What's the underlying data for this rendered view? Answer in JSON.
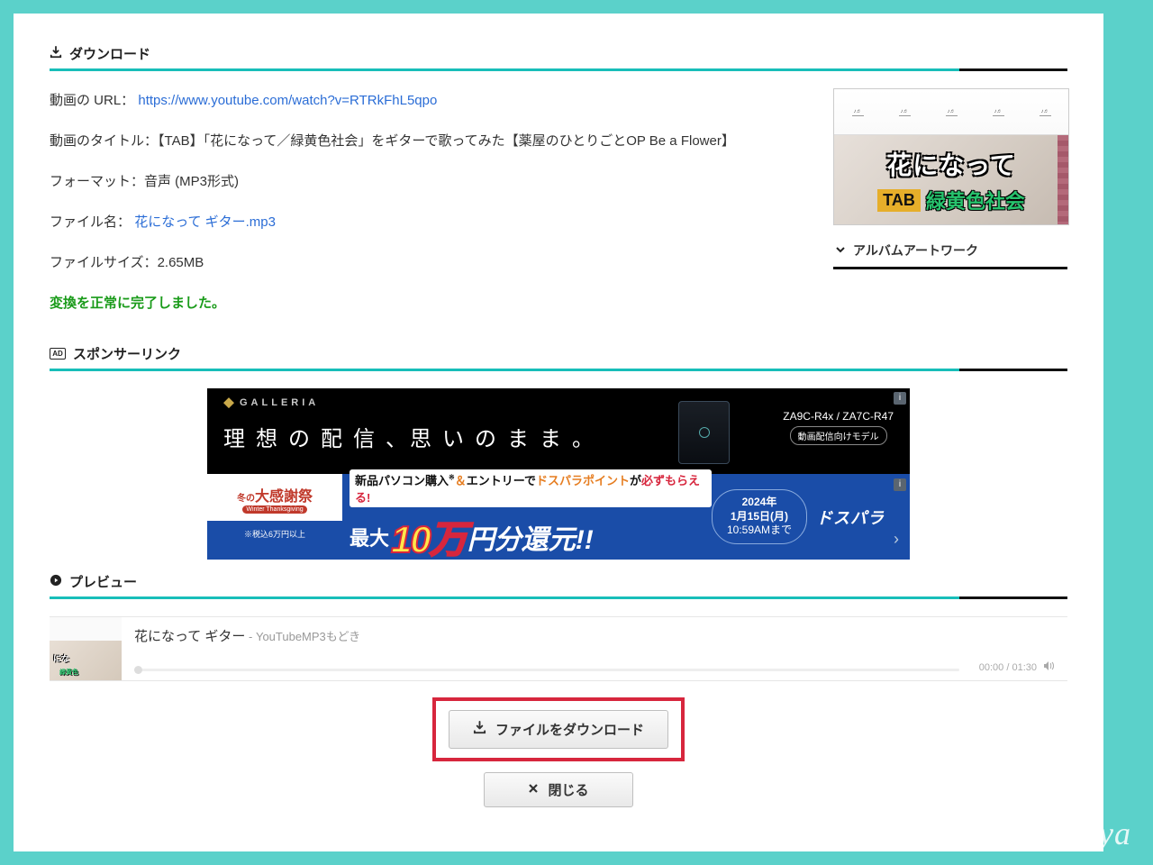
{
  "sections": {
    "download": "ダウンロード",
    "sponsor": "スポンサーリンク",
    "preview": "プレビュー"
  },
  "info": {
    "url_label": "動画の URL：",
    "url": "https://www.youtube.com/watch?v=RTRkFhL5qpo",
    "title_label": "動画のタイトル：",
    "title": "【TAB】「花になって／緑黄色社会」をギターで歌ってみた【薬屋のひとりごとOP Be a Flower】",
    "format_label": "フォーマット：",
    "format": "音声 (MP3形式)",
    "file_label": "ファイル名：",
    "file": "花になって ギター.mp3",
    "size_label": "ファイルサイズ：",
    "size": "2.65MB",
    "status": "変換を正常に完了しました。"
  },
  "thumb": {
    "line1": "花になって",
    "tab": "TAB",
    "line2": "緑黄色社会"
  },
  "artwork": {
    "label": "アルバムアートワーク"
  },
  "ad": {
    "brand_top": "GALLERIA",
    "headline": "理 想 の 配 信 、思 い の ま ま 。",
    "model": "ZA9C-R4x / ZA7C-R47",
    "model_sub": "動画配信向けモデル",
    "fest_top_pre": "冬の",
    "fest_top_big": "大感謝祭",
    "fest_rib": "Winter Thanksgiving",
    "fest_bot": "※税込6万円以上",
    "line1_a": "新品パソコン購入",
    "line1_amp": "＆",
    "line1_b": "エントリーで",
    "line1_c": "ドスパラポイント",
    "line1_d": "が",
    "line1_red": "必ずもらえる!",
    "line2_pre": "最大",
    "line2_num": "10万",
    "line2_post": "円分還元!!",
    "date_l1": "2024年",
    "date_l2": "1月15日(月)",
    "date_l3": "10:59AMまで",
    "brand_bot": "ドスパラ"
  },
  "preview": {
    "title": "花になって ギター",
    "sub": " - YouTubeMP3もどき",
    "time": "00:00 / 01:30"
  },
  "buttons": {
    "download": "ファイルをダウンロード",
    "close": "閉じる"
  },
  "watermark": "noribeya"
}
